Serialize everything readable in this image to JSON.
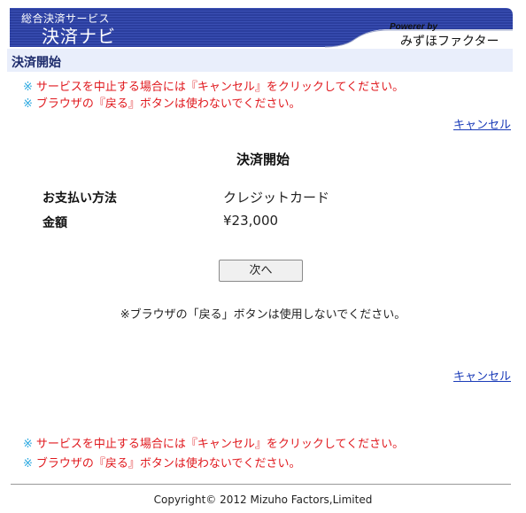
{
  "header": {
    "brand_sub": "総合決済サービス",
    "brand_main": "決済ナビ",
    "powered_by": "Powerer by",
    "company": "みずほファクター"
  },
  "section": {
    "title": "決済開始"
  },
  "notices_top": [
    {
      "mark": "※",
      "text": "サービスを中止する場合には『キャンセル』をクリックしてください。"
    },
    {
      "mark": "※",
      "text": "ブラウザの『戻る』ボタンは使わないでください。"
    }
  ],
  "cancel_label": "キャンセル",
  "main": {
    "heading": "決済開始",
    "rows": [
      {
        "label": "お支払い方法",
        "value": "クレジットカード"
      },
      {
        "label": "金額",
        "value": "¥23,000"
      }
    ],
    "next_button": "次へ",
    "browser_note": "※ブラウザの「戻る」ボタンは使用しないでください。"
  },
  "notices_bottom": [
    {
      "mark": "※",
      "text": "サービスを中止する場合には『キャンセル』をクリックしてください。"
    },
    {
      "mark": "※",
      "text": "ブラウザの『戻る』ボタンは使わないでください。"
    }
  ],
  "footer": {
    "copyright": "Copyright© 2012 Mizuho Factors,Limited"
  },
  "colors": {
    "banner_blue": "#2a3d9c",
    "notice_red": "#e0191e",
    "notice_mark_blue": "#2aa8e0",
    "link_blue": "#1a3bb8",
    "section_bg": "#e9eefb"
  }
}
